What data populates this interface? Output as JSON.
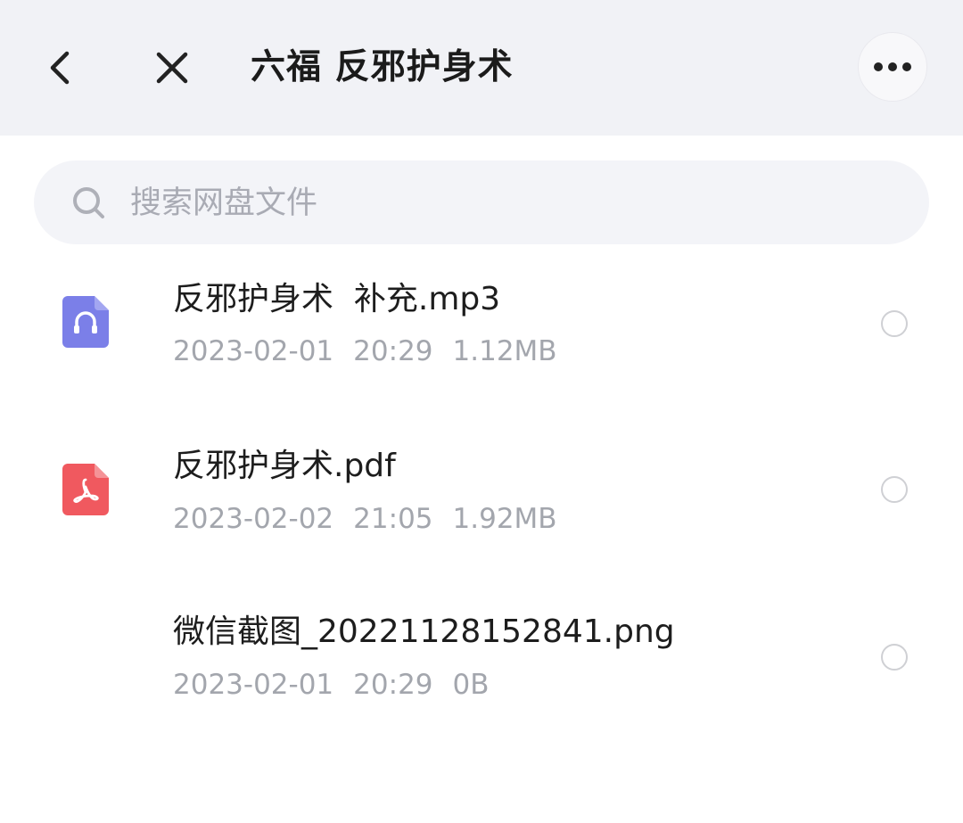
{
  "header": {
    "title": "六福 反邪护身术"
  },
  "search": {
    "placeholder": "搜索网盘文件"
  },
  "files": [
    {
      "name": "反邪护身术  补充.mp3",
      "date": "2023-02-01",
      "time": "20:29",
      "size": "1.12MB",
      "icon": "audio-file-icon",
      "icon_color": "#7b7fe8"
    },
    {
      "name": "反邪护身术.pdf",
      "date": "2023-02-02",
      "time": "21:05",
      "size": "1.92MB",
      "icon": "pdf-file-icon",
      "icon_color": "#f0595f"
    },
    {
      "name": "微信截图_20221128152841.png",
      "date": "2023-02-01",
      "time": "20:29",
      "size": "0B",
      "icon": "none"
    }
  ],
  "colors": {
    "header_bg": "#f1f2f6",
    "search_bg": "#f3f4f8",
    "text_primary": "#1d1d1d",
    "text_secondary": "#a3a6ad"
  }
}
